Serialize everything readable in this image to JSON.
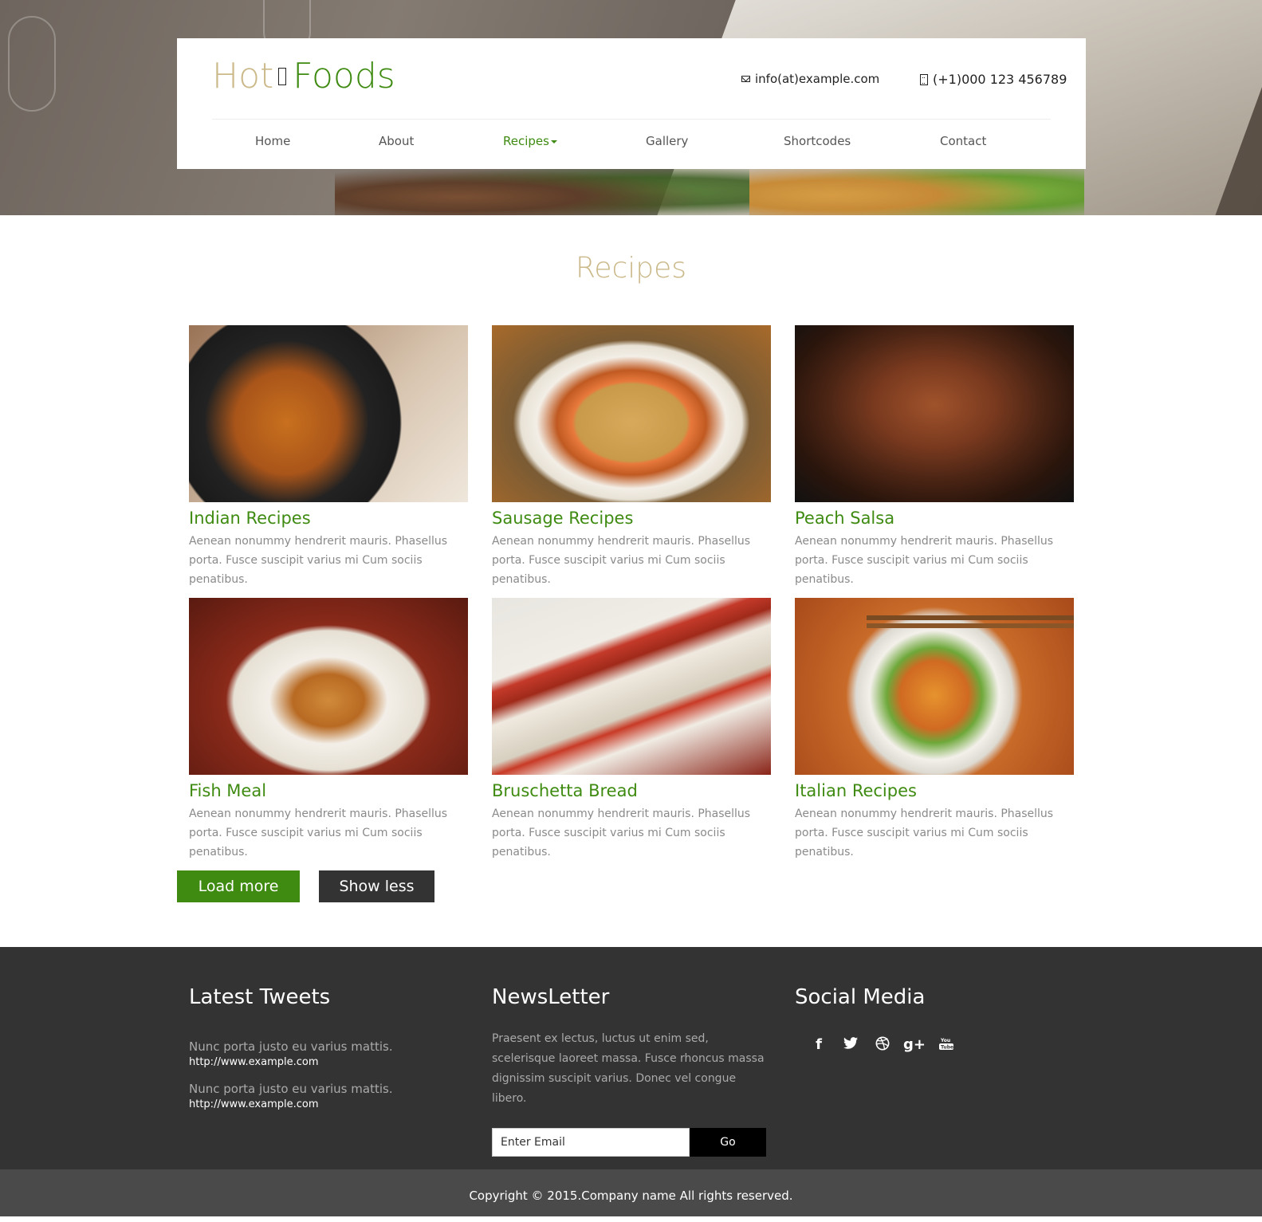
{
  "brand": {
    "hot": "Hot",
    "foods": "Foods",
    "hot_color": "#cbb98a",
    "foods_color": "#3f8b12"
  },
  "contact": {
    "email": "info(at)example.com",
    "phone": "(+1)000 123 456789"
  },
  "nav": [
    {
      "label": "Home"
    },
    {
      "label": "About"
    },
    {
      "label": "Recipes",
      "active": true
    },
    {
      "label": "Gallery"
    },
    {
      "label": "Shortcodes"
    },
    {
      "label": "Contact"
    }
  ],
  "section_title": "Recipes",
  "recipes": [
    {
      "title": "Indian Recipes",
      "desc": "Aenean nonummy hendrerit mauris. Phasellus porta. Fusce suscipit varius mi Cum sociis penatibus."
    },
    {
      "title": "Sausage Recipes",
      "desc": "Aenean nonummy hendrerit mauris. Phasellus porta. Fusce suscipit varius mi Cum sociis penatibus."
    },
    {
      "title": "Peach Salsa",
      "desc": "Aenean nonummy hendrerit mauris. Phasellus porta. Fusce suscipit varius mi Cum sociis penatibus."
    },
    {
      "title": "Fish Meal",
      "desc": "Aenean nonummy hendrerit mauris. Phasellus porta. Fusce suscipit varius mi Cum sociis penatibus."
    },
    {
      "title": "Bruschetta Bread",
      "desc": "Aenean nonummy hendrerit mauris. Phasellus porta. Fusce suscipit varius mi Cum sociis penatibus."
    },
    {
      "title": "Italian Recipes",
      "desc": "Aenean nonummy hendrerit mauris. Phasellus porta. Fusce suscipit varius mi Cum sociis penatibus."
    }
  ],
  "buttons": {
    "load_more": "Load more",
    "show_less": "Show less"
  },
  "footer": {
    "tweets_title": "Latest Tweets",
    "tweets": [
      {
        "text": "Nunc porta justo eu varius mattis.",
        "link": "http://www.example.com"
      },
      {
        "text": "Nunc porta justo eu varius mattis.",
        "link": "http://www.example.com"
      }
    ],
    "newsletter_title": "NewsLetter",
    "newsletter_text": "Praesent ex lectus, luctus ut enim sed, scelerisque laoreet massa. Fusce rhoncus massa dignissim suscipit varius. Donec vel congue libero.",
    "email_placeholder": "Enter Email",
    "go_label": "Go",
    "social_title": "Social Media",
    "social_icons": [
      "facebook-icon",
      "twitter-icon",
      "dribbble-icon",
      "google-plus-icon",
      "youtube-icon"
    ]
  },
  "copyright": "Copyright © 2015.Company name All rights reserved."
}
